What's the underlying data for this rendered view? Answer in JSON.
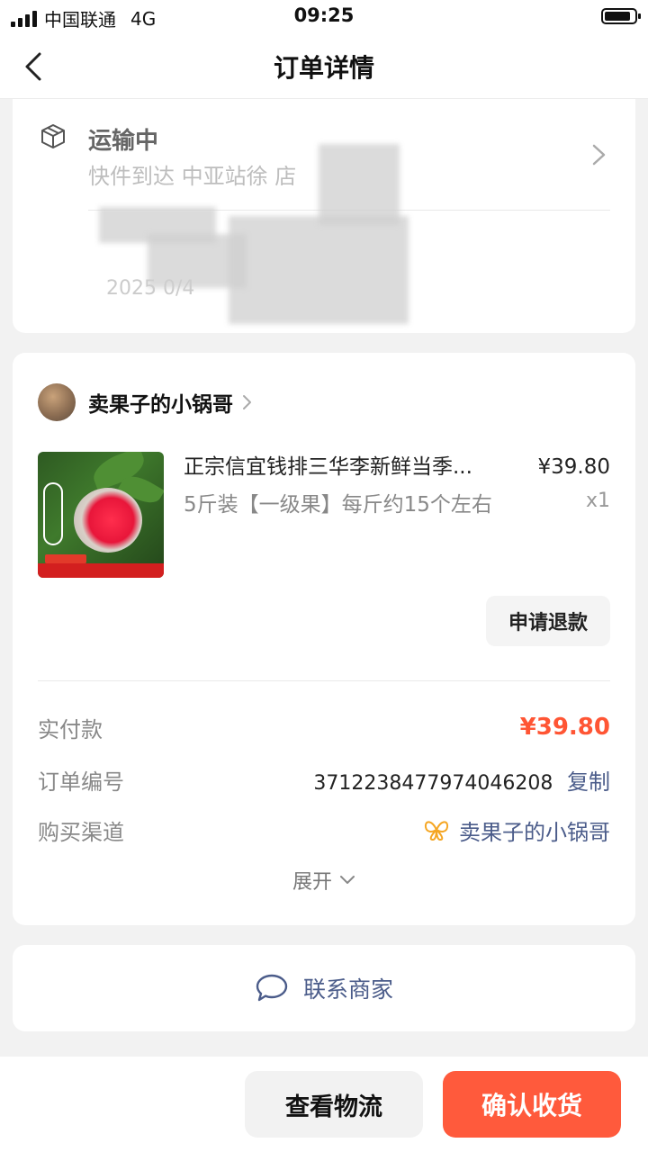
{
  "status_bar": {
    "carrier": "中国联通",
    "network": "4G",
    "time": "09:25"
  },
  "nav": {
    "title": "订单详情",
    "back_icon": "chevron-left-icon"
  },
  "shipping": {
    "status": "运输中",
    "description": "快件到达 中亚站徐 店",
    "date": "2025 0/4",
    "icon": "package-icon"
  },
  "order": {
    "shop_name": "卖果子的小锅哥",
    "product": {
      "title": "正宗信宜钱排三华李新鲜当季...",
      "spec": "5斤装【一级果】每斤约15个左右",
      "price": "¥39.80",
      "quantity": "x1"
    },
    "refund_label": "申请退款",
    "rows": {
      "paid_label": "实付款",
      "paid_value": "¥39.80",
      "order_no_label": "订单编号",
      "order_no_value": "3712238477974046208",
      "copy_label": "复制",
      "channel_label": "购买渠道",
      "channel_value": "卖果子的小锅哥"
    },
    "expand_label": "展开"
  },
  "contact": {
    "label": "联系商家",
    "icon": "chat-bubble-icon"
  },
  "bottom": {
    "logistics_label": "查看物流",
    "confirm_label": "确认收货"
  },
  "colors": {
    "accent": "#ff5a3c",
    "price_red": "#ff5534",
    "link_blue": "#4b5c8a",
    "channel_icon": "#f5a623"
  }
}
